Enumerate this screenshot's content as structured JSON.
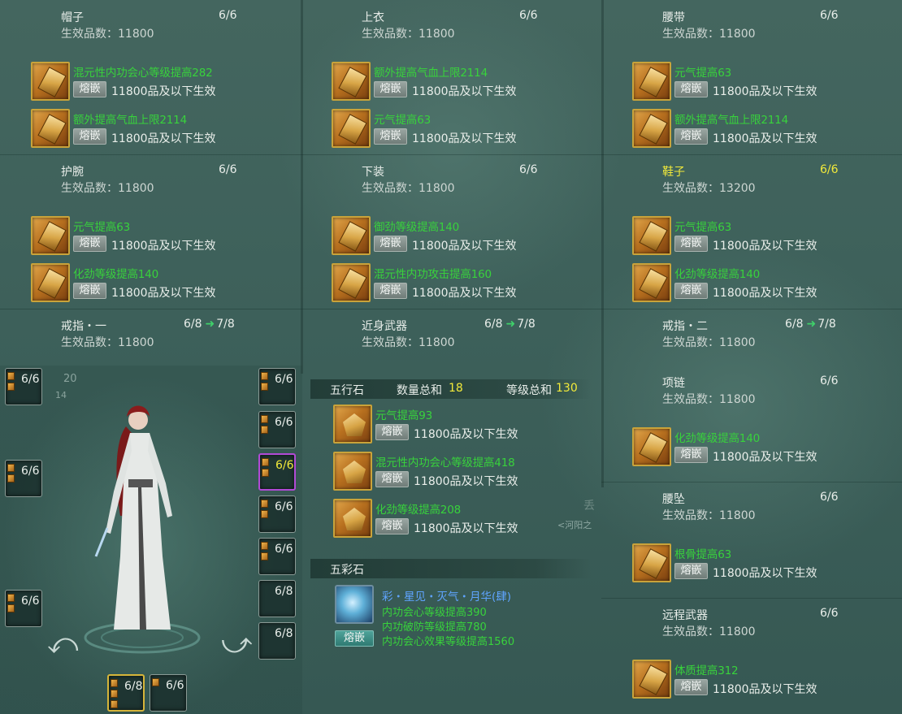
{
  "common": {
    "tag": "熔嵌"
  },
  "cards": {
    "hat": {
      "title": "帽子",
      "count": "6/6",
      "grade": "生效品数：11800",
      "gems": [
        {
          "name": "混元性内功会心等级提高282",
          "effect": "11800品及以下生效"
        },
        {
          "name": "额外提高气血上限2114",
          "effect": "11800品及以下生效"
        }
      ]
    },
    "top": {
      "title": "上衣",
      "count": "6/6",
      "grade": "生效品数：11800",
      "gems": [
        {
          "name": "额外提高气血上限2114",
          "effect": "11800品及以下生效"
        },
        {
          "name": "元气提高63",
          "effect": "11800品及以下生效"
        }
      ]
    },
    "belt": {
      "title": "腰带",
      "count": "6/6",
      "grade": "生效品数：11800",
      "gems": [
        {
          "name": "元气提高63",
          "effect": "11800品及以下生效"
        },
        {
          "name": "额外提高气血上限2114",
          "effect": "11800品及以下生效"
        }
      ]
    },
    "wrist": {
      "title": "护腕",
      "count": "6/6",
      "grade": "生效品数：11800",
      "gems": [
        {
          "name": "元气提高63",
          "effect": "11800品及以下生效"
        },
        {
          "name": "化劲等级提高140",
          "effect": "11800品及以下生效"
        }
      ]
    },
    "pants": {
      "title": "下装",
      "count": "6/6",
      "grade": "生效品数：11800",
      "gems": [
        {
          "name": "御劲等级提高140",
          "effect": "11800品及以下生效"
        },
        {
          "name": "混元性内功攻击提高160",
          "effect": "11800品及以下生效"
        }
      ]
    },
    "shoes": {
      "title": "鞋子",
      "count": "6/6",
      "grade": "生效品数：13200",
      "gems": [
        {
          "name": "元气提高63",
          "effect": "11800品及以下生效"
        },
        {
          "name": "化劲等级提高140",
          "effect": "11800品及以下生效"
        }
      ]
    },
    "ring1": {
      "title": "戒指・一",
      "count": "6/8",
      "next": "7/8",
      "grade": "生效品数：11800"
    },
    "melee": {
      "title": "近身武器",
      "count": "6/8",
      "next": "7/8",
      "grade": "生效品数：11800"
    },
    "ring2": {
      "title": "戒指・二",
      "count": "6/8",
      "next": "7/8",
      "grade": "生效品数：11800"
    },
    "necklace": {
      "title": "项链",
      "count": "6/6",
      "grade": "生效品数：11800",
      "gems": [
        {
          "name": "化劲等级提高140",
          "effect": "11800品及以下生效"
        }
      ]
    },
    "pendant": {
      "title": "腰坠",
      "count": "6/6",
      "grade": "生效品数：11800",
      "gems": [
        {
          "name": "根骨提高63",
          "effect": "11800品及以下生效"
        }
      ]
    },
    "ranged": {
      "title": "远程武器",
      "count": "6/6",
      "grade": "生效品数：11800",
      "gems": [
        {
          "name": "体质提高312",
          "effect": "11800品及以下生效"
        }
      ]
    }
  },
  "wuxing": {
    "title": "五行石",
    "qty_label": "数量总和",
    "qty": "18",
    "lvl_label": "等级总和",
    "lvl": "130",
    "gems": [
      {
        "name": "元气提高93",
        "effect": "11800品及以下生效"
      },
      {
        "name": "混元性内功会心等级提高418",
        "effect": "11800品及以下生效"
      },
      {
        "name": "化劲等级提高208",
        "effect": "11800品及以下生效"
      }
    ]
  },
  "wucai": {
    "title": "五彩石",
    "name": "彩・星见・灭气・月华(肆)",
    "attrs": [
      "内功会心等级提高390",
      "内功破防等级提高780",
      "内功会心效果等级提高1560"
    ],
    "tag": "熔嵌"
  },
  "character": {
    "left_slots": [
      "6/6",
      "6/6",
      "6/6"
    ],
    "right_slots": [
      "6/6",
      "6/6",
      "6/6",
      "6/6",
      "6/6",
      "6/8",
      "6/8"
    ],
    "bottom_slots": [
      "6/8",
      "6/6"
    ],
    "ring_numbers": [
      "20",
      "14"
    ]
  },
  "map_hint": "<河阳之",
  "map_hint2": "丢"
}
